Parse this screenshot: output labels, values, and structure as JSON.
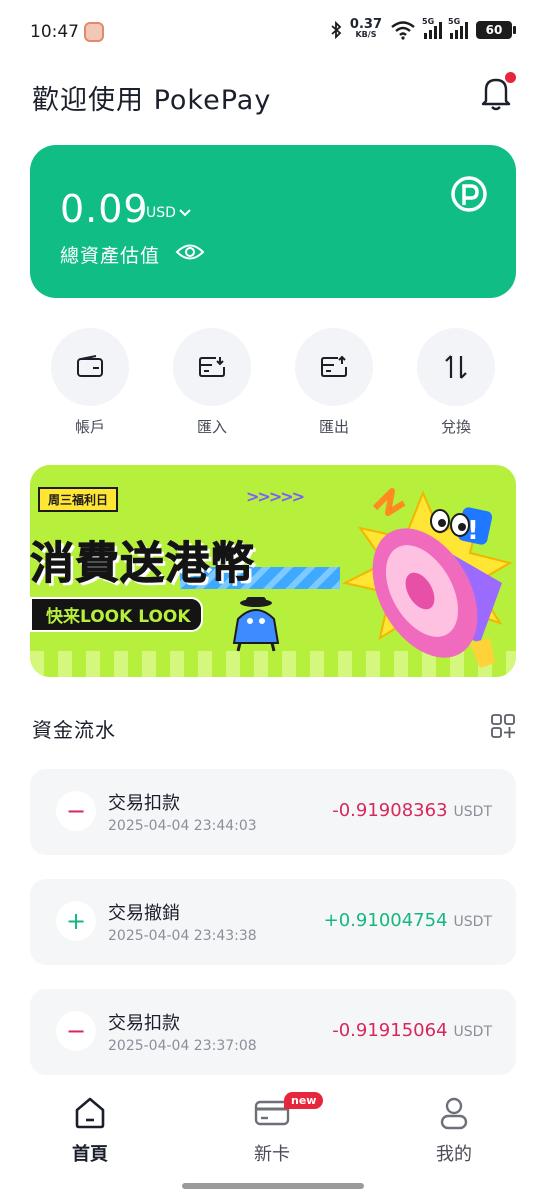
{
  "status_bar": {
    "time": "10:47",
    "net_speed_value": "0.37",
    "net_speed_unit": "KB/S",
    "sim1": "5G",
    "sim2": "5G",
    "battery": "60"
  },
  "header": {
    "title": "歡迎使用 PokePay"
  },
  "balance": {
    "amount": "0.09",
    "currency": "USD",
    "label": "總資產估值",
    "card_color": "#10bd85"
  },
  "actions": [
    {
      "label": "帳戶",
      "icon": "wallet-icon"
    },
    {
      "label": "匯入",
      "icon": "deposit-icon"
    },
    {
      "label": "匯出",
      "icon": "withdraw-icon"
    },
    {
      "label": "兌換",
      "icon": "exchange-icon"
    }
  ],
  "banner": {
    "tag": "周三福利日",
    "title": "消費送港幣",
    "button": "快来LOOK LOOK"
  },
  "flow": {
    "title": "資金流水"
  },
  "transactions": [
    {
      "sign": "−",
      "title": "交易扣款",
      "time": "2025-04-04 23:44:03",
      "amount": "-0.91908363",
      "unit": "USDT"
    },
    {
      "sign": "+",
      "title": "交易撤銷",
      "time": "2025-04-04 23:43:38",
      "amount": "+0.91004754",
      "unit": "USDT"
    },
    {
      "sign": "−",
      "title": "交易扣款",
      "time": "2025-04-04 23:37:08",
      "amount": "-0.91915064",
      "unit": "USDT"
    }
  ],
  "nav": {
    "home": "首頁",
    "card": "新卡",
    "card_badge": "new",
    "me": "我的"
  },
  "colors": {
    "accent": "#10bd85",
    "negative": "#d8285a",
    "positive": "#14b87f",
    "badge": "#e8263b"
  }
}
